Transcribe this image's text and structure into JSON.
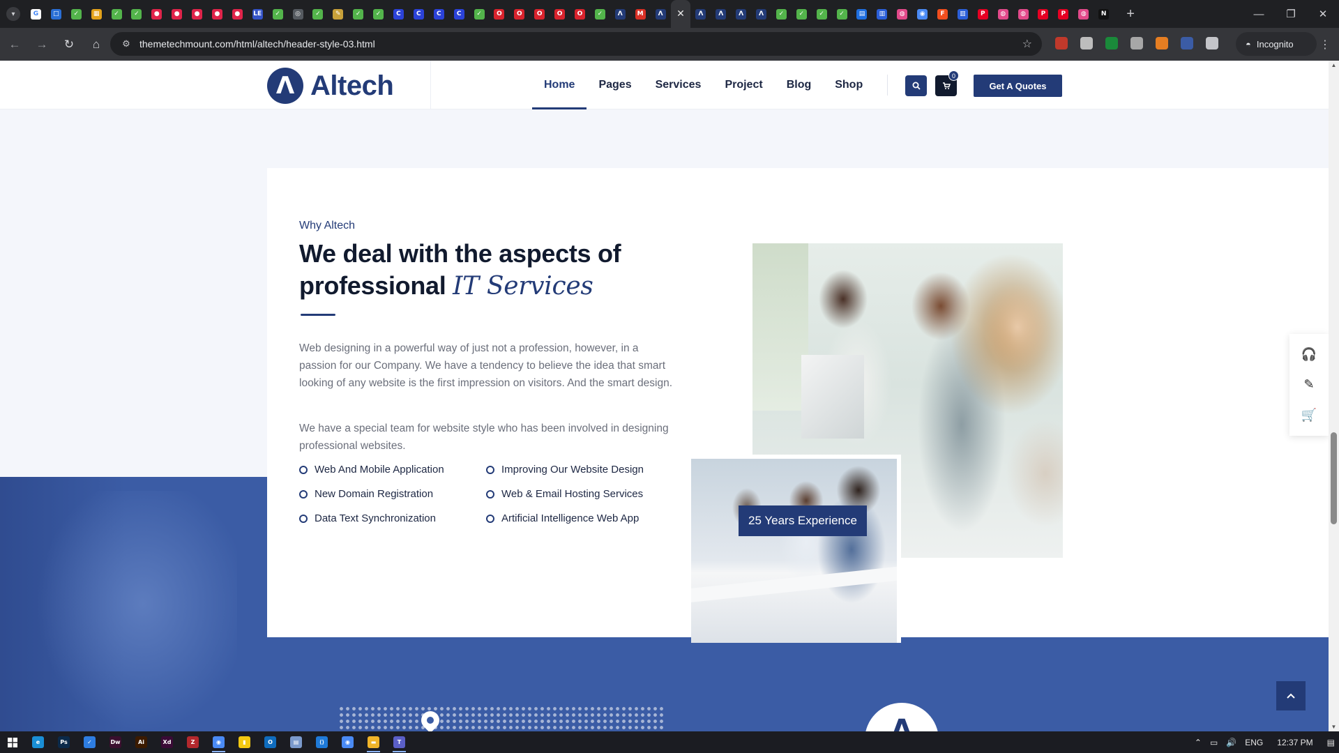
{
  "browser": {
    "url": "themetechmount.com/html/altech/header-style-03.html",
    "incognito_label": "Incognito",
    "tab_close_glyph": "✕",
    "new_tab_glyph": "+",
    "tabs": [
      {
        "icon": "google-icon",
        "letter": "G",
        "color": "#ffffff"
      },
      {
        "icon": "web-icon",
        "letter": "□",
        "color": "#2a6fd6"
      },
      {
        "icon": "leaf-icon",
        "letter": "✓",
        "color": "#53b44b"
      },
      {
        "icon": "building-icon",
        "letter": "▦",
        "color": "#e3a21a"
      },
      {
        "icon": "leaf-icon",
        "letter": "✓",
        "color": "#53b44b"
      },
      {
        "icon": "leaf-icon",
        "letter": "✓",
        "color": "#53b44b"
      },
      {
        "icon": "record-icon",
        "letter": "●",
        "color": "#e0244a"
      },
      {
        "icon": "record-icon",
        "letter": "●",
        "color": "#e0244a"
      },
      {
        "icon": "record-icon",
        "letter": "●",
        "color": "#e0244a"
      },
      {
        "icon": "record-icon",
        "letter": "●",
        "color": "#e0244a"
      },
      {
        "icon": "record-icon",
        "letter": "●",
        "color": "#e0244a"
      },
      {
        "icon": "le-icon",
        "letter": "LE",
        "color": "#3453c8"
      },
      {
        "icon": "leaf-icon",
        "letter": "✓",
        "color": "#53b44b"
      },
      {
        "icon": "globe-icon",
        "letter": "◎",
        "color": "#555a60"
      },
      {
        "icon": "leaf-icon",
        "letter": "✓",
        "color": "#53b44b"
      },
      {
        "icon": "tool-icon",
        "letter": "✎",
        "color": "#c8a13a"
      },
      {
        "icon": "leaf-icon",
        "letter": "✓",
        "color": "#53b44b"
      },
      {
        "icon": "leaf-icon",
        "letter": "✓",
        "color": "#53b44b"
      },
      {
        "icon": "c-icon",
        "letter": "C",
        "color": "#2b42d8"
      },
      {
        "icon": "c-icon",
        "letter": "C",
        "color": "#2b42d8"
      },
      {
        "icon": "c-icon",
        "letter": "C",
        "color": "#2b42d8"
      },
      {
        "icon": "c-icon",
        "letter": "C",
        "color": "#2b42d8"
      },
      {
        "icon": "leaf-icon",
        "letter": "✓",
        "color": "#53b44b"
      },
      {
        "icon": "opera-icon",
        "letter": "O",
        "color": "#d9232d"
      },
      {
        "icon": "opera-icon",
        "letter": "O",
        "color": "#d9232d"
      },
      {
        "icon": "opera-icon",
        "letter": "O",
        "color": "#d9232d"
      },
      {
        "icon": "opera-icon",
        "letter": "O",
        "color": "#d9232d"
      },
      {
        "icon": "opera-icon",
        "letter": "O",
        "color": "#d9232d"
      },
      {
        "icon": "leaf-icon",
        "letter": "✓",
        "color": "#53b44b"
      },
      {
        "icon": "altech-icon",
        "letter": "Λ",
        "color": "#233b77"
      },
      {
        "icon": "gmail-icon",
        "letter": "M",
        "color": "#d93025"
      },
      {
        "icon": "altech-icon",
        "letter": "Λ",
        "color": "#233b77"
      },
      {
        "icon": "altech-icon",
        "letter": "Λ",
        "color": "#233b77",
        "active": true
      },
      {
        "icon": "altech-icon",
        "letter": "Λ",
        "color": "#233b77"
      },
      {
        "icon": "altech-icon",
        "letter": "Λ",
        "color": "#233b77"
      },
      {
        "icon": "altech-icon",
        "letter": "Λ",
        "color": "#233b77"
      },
      {
        "icon": "altech-icon",
        "letter": "Λ",
        "color": "#233b77"
      },
      {
        "icon": "leaf-icon",
        "letter": "✓",
        "color": "#53b44b"
      },
      {
        "icon": "leaf-icon",
        "letter": "✓",
        "color": "#53b44b"
      },
      {
        "icon": "leaf-icon",
        "letter": "✓",
        "color": "#53b44b"
      },
      {
        "icon": "leaf-icon",
        "letter": "✓",
        "color": "#53b44b"
      },
      {
        "icon": "trello-icon",
        "letter": "▤",
        "color": "#1f6fe0"
      },
      {
        "icon": "docs-icon",
        "letter": "▥",
        "color": "#2b5fd9"
      },
      {
        "icon": "dribbble-icon",
        "letter": "◍",
        "color": "#e2498a"
      },
      {
        "icon": "chrome-icon",
        "letter": "◉",
        "color": "#4a8af4"
      },
      {
        "icon": "figma-icon",
        "letter": "F",
        "color": "#f24e1e"
      },
      {
        "icon": "docs-icon",
        "letter": "▥",
        "color": "#2b5fd9"
      },
      {
        "icon": "pinterest-icon",
        "letter": "P",
        "color": "#e60023"
      },
      {
        "icon": "dribbble-icon",
        "letter": "◍",
        "color": "#e2498a"
      },
      {
        "icon": "dribbble-icon",
        "letter": "◍",
        "color": "#e2498a"
      },
      {
        "icon": "pinterest-icon",
        "letter": "P",
        "color": "#e60023"
      },
      {
        "icon": "pinterest-icon",
        "letter": "P",
        "color": "#e60023"
      },
      {
        "icon": "dribbble-icon",
        "letter": "◍",
        "color": "#e2498a"
      },
      {
        "icon": "notion-icon",
        "letter": "N",
        "color": "#111111"
      }
    ],
    "extensions": [
      {
        "icon": "extension-red-icon",
        "color": "#c0392b"
      },
      {
        "icon": "extension-print-icon",
        "color": "#bdbdbd"
      },
      {
        "icon": "extension-behance-icon",
        "color": "#1a8a3a"
      },
      {
        "icon": "extension-camera-icon",
        "color": "#a7a7a7"
      },
      {
        "icon": "extension-fire-icon",
        "color": "#e67e22"
      },
      {
        "icon": "extension-blue-icon",
        "color": "#3b5ca5"
      },
      {
        "icon": "extensions-puzzle-icon",
        "color": "#c4c5c9"
      }
    ]
  },
  "site": {
    "brand": {
      "mark": "Λ",
      "name": "Altech",
      "color": "#233b77"
    },
    "nav": [
      "Home",
      "Pages",
      "Services",
      "Project",
      "Blog",
      "Shop"
    ],
    "cart_count": "0",
    "cta": "Get A Quotes",
    "about": {
      "eyebrow": "Why Altech",
      "heading_plain": "We deal with the aspects of professional",
      "heading_highlight": "IT Services",
      "para1": "Web designing in a powerful way of just not a profession, however, in a passion for our Company. We have a tendency to believe the idea that smart looking of any website is the first impression on visitors. And the smart design.",
      "para2": "We have a special team for website style who has been involved in designing professional websites.",
      "features": [
        "Web And Mobile Application",
        "Improving Our Website Design",
        "New Domain Registration",
        "Web & Email Hosting Services",
        "Data Text Synchronization",
        "Artificial Intelligence Web App"
      ],
      "experience_badge": "25 Years Experience"
    },
    "float_tools": [
      "headset-icon",
      "pen-icon",
      "cart-icon"
    ]
  },
  "taskbar": {
    "apps": [
      {
        "icon": "edge-icon",
        "letter": "e",
        "color": "#1a8fd6"
      },
      {
        "icon": "photoshop-icon",
        "letter": "Ps",
        "color": "#0b2a4a"
      },
      {
        "icon": "tick-icon",
        "letter": "✓",
        "color": "#2e7de1"
      },
      {
        "icon": "dreamweaver-icon",
        "letter": "Dw",
        "color": "#3a0f2e"
      },
      {
        "icon": "illustrator-icon",
        "letter": "Ai",
        "color": "#3b1a00"
      },
      {
        "icon": "xd-icon",
        "letter": "Xd",
        "color": "#3a0b36"
      },
      {
        "icon": "filezilla-icon",
        "letter": "Z",
        "color": "#b3282d"
      },
      {
        "icon": "chrome-icon",
        "letter": "◉",
        "color": "#4a8af4",
        "open": true
      },
      {
        "icon": "sticky-notes-icon",
        "letter": "▮",
        "color": "#f2c811"
      },
      {
        "icon": "outlook-icon",
        "letter": "O",
        "color": "#0f6cbd"
      },
      {
        "icon": "notepad-icon",
        "letter": "▤",
        "color": "#7b9acc"
      },
      {
        "icon": "vscode-icon",
        "letter": "⟨⟩",
        "color": "#1f7ad8"
      },
      {
        "icon": "chrome-icon",
        "letter": "◉",
        "color": "#4a8af4"
      },
      {
        "icon": "file-explorer-icon",
        "letter": "▬",
        "color": "#f0b429",
        "open": true
      },
      {
        "icon": "teams-icon",
        "letter": "T",
        "color": "#5b5fc7",
        "open": true
      }
    ],
    "language": "ENG",
    "time": "12:37 PM"
  }
}
